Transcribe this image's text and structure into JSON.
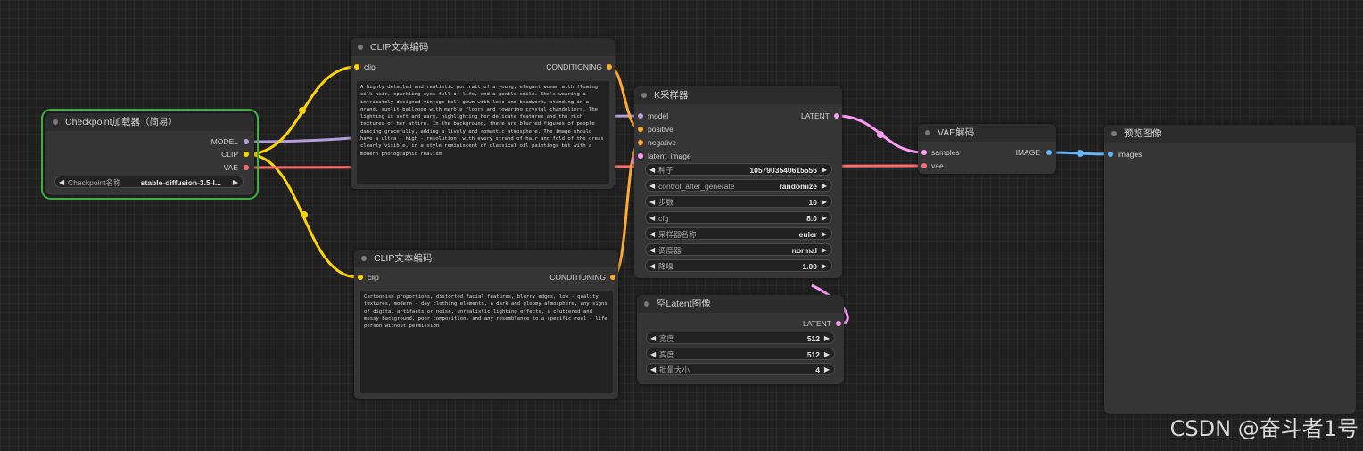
{
  "colors": {
    "canvas": "#202020",
    "node_body": "#353535",
    "node_title": "#2c2c2c",
    "selected_outline": "#3fae3f",
    "model": "#b39ddb",
    "clip": "#ffd500",
    "vae": "#ff6e6e",
    "conditioning": "#ffa931",
    "latent": "#ff9cf9",
    "image": "#64b5f6"
  },
  "nodes": {
    "checkpoint": {
      "title": "Checkpoint加载器（简易）",
      "outputs": [
        "MODEL",
        "CLIP",
        "VAE"
      ],
      "widget_label": "Checkpoint名称",
      "widget_value": "stable-diffusion-3.5-l..."
    },
    "clip_pos": {
      "title": "CLIP文本编码",
      "input": "clip",
      "output": "CONDITIONING",
      "text": "A highly detailed and realistic portrait of a young, elegant woman with flowing silk hair, sparkling eyes full of life, and a gentle smile. She's wearing a intricately designed vintage ball gown with lace and beadwork, standing in a grand, sunlit ballroom with marble floors and towering crystal chandeliers. The lighting is soft and warm, highlighting her delicate features and the rich textures of her attire. In the background, there are blurred figures of people dancing gracefully, adding a lively and romantic atmosphere. The image should have a ultra - high - resolution, with every strand of hair and fold of the dress clearly visible, in a style reminiscent of classical oil paintings but with a modern photographic realism"
    },
    "clip_neg": {
      "title": "CLIP文本编码",
      "input": "clip",
      "output": "CONDITIONING",
      "text": "Cartoonish proportions, distorted facial features, blurry edges, low - quality textures, modern - day clothing elements, a dark and gloomy atmosphere, any signs of digital artifacts or noise, unrealistic lighting effects, a cluttered and messy background, poor composition, and any resemblance to a specific real - life person without permission"
    },
    "ksampler": {
      "title": "K采样器",
      "inputs": [
        "model",
        "positive",
        "negative",
        "latent_image"
      ],
      "output": "LATENT",
      "widgets": [
        {
          "label": "种子",
          "value": "1057903540615556"
        },
        {
          "label": "control_after_generate",
          "value": "randomize"
        },
        {
          "label": "步数",
          "value": "10"
        },
        {
          "label": "cfg",
          "value": "8.0"
        },
        {
          "label": "采样器名称",
          "value": "euler"
        },
        {
          "label": "调度器",
          "value": "normal"
        },
        {
          "label": "降噪",
          "value": "1.00"
        }
      ]
    },
    "latent": {
      "title": "空Latent图像",
      "output": "LATENT",
      "widgets": [
        {
          "label": "宽度",
          "value": "512"
        },
        {
          "label": "高度",
          "value": "512"
        },
        {
          "label": "批量大小",
          "value": "4"
        }
      ]
    },
    "vae_decode": {
      "title": "VAE解码",
      "inputs": [
        "samples",
        "vae"
      ],
      "output": "IMAGE"
    },
    "preview": {
      "title": "预览图像",
      "input": "images"
    }
  },
  "watermark": "CSDN @奋斗者1号"
}
